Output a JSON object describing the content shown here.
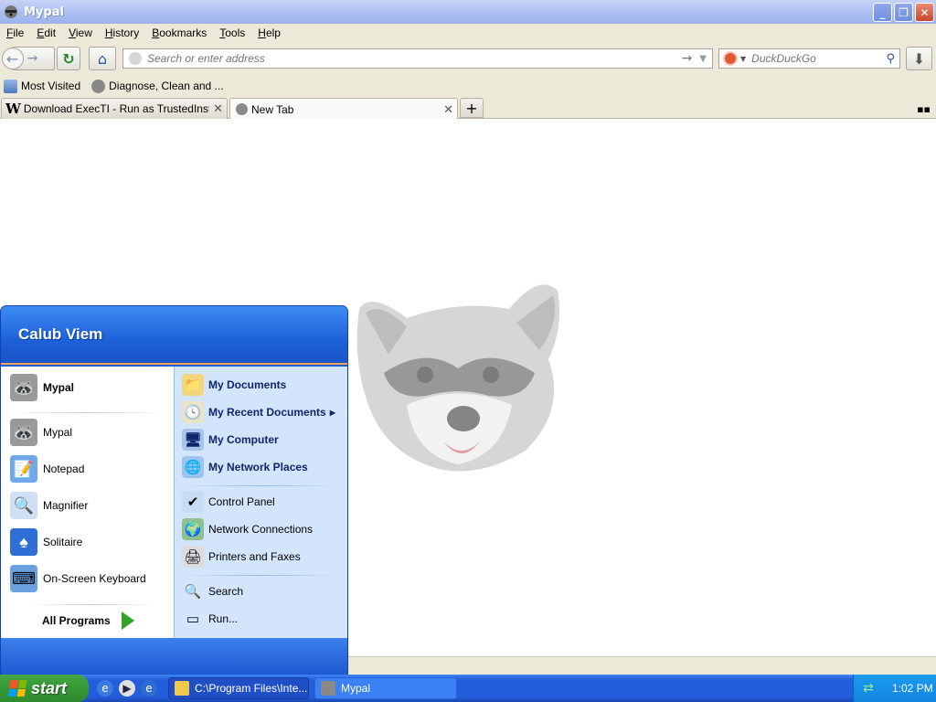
{
  "window": {
    "title": "Mypal"
  },
  "menubar": {
    "items": [
      "File",
      "Edit",
      "View",
      "History",
      "Bookmarks",
      "Tools",
      "Help"
    ]
  },
  "navbar": {
    "url_placeholder": "Search or enter address",
    "search_engine": "DuckDuckGo"
  },
  "bookmarks": {
    "items": [
      "Most Visited",
      "Diagnose, Clean and ..."
    ]
  },
  "tabs": [
    {
      "label": "Download ExecTI - Run as TrustedInstaller",
      "favicon": "W"
    },
    {
      "label": "New Tab"
    }
  ],
  "start_menu": {
    "user": "Calub Viem",
    "pinned": "Mypal",
    "recent": [
      "Mypal",
      "Notepad",
      "Magnifier",
      "Solitaire",
      "On-Screen Keyboard"
    ],
    "all_programs": "All Programs",
    "right_bold": [
      "My Documents",
      "My Recent Documents",
      "My Computer",
      "My Network Places"
    ],
    "right_system": [
      "Control Panel",
      "Network Connections",
      "Printers and Faxes"
    ],
    "right_tools": [
      "Search",
      "Run..."
    ]
  },
  "taskbar": {
    "start": "start",
    "tasks": [
      "C:\\Program Files\\Inte...",
      "Mypal"
    ],
    "clock": "1:02 PM"
  },
  "colors": {
    "start_menu_blue": "#1c5fd6",
    "start_button_green": "#379a37",
    "taskbar_blue": "#245ddb"
  }
}
